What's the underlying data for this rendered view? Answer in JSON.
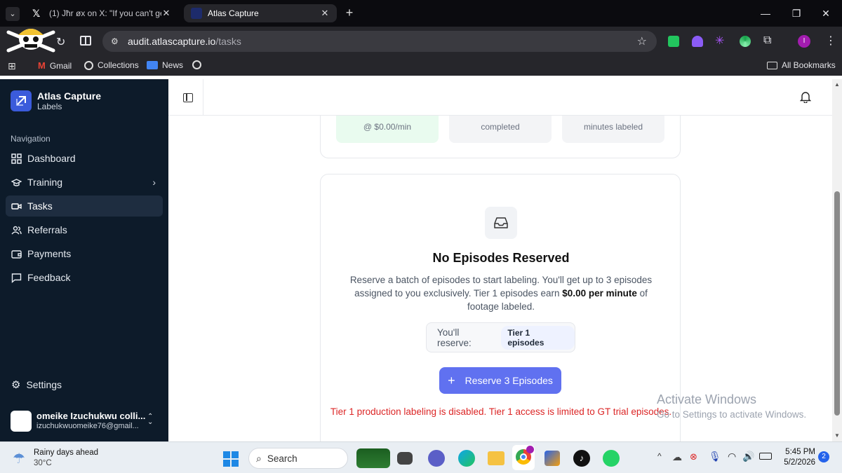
{
  "browser": {
    "tabs": [
      {
        "title": "(1) Jħr øx on X: \"If you can't get",
        "active": false
      },
      {
        "title": "Atlas Capture",
        "active": true
      }
    ],
    "url_domain": "audit.atlascapture.io",
    "url_path": "/tasks",
    "bookmarks": [
      "Gmail",
      "Collections",
      "News"
    ],
    "all_bookmarks": "All Bookmarks",
    "profile_initial": "I"
  },
  "app": {
    "name": "Atlas Capture",
    "subtitle": "Labels",
    "nav_heading": "Navigation",
    "nav": [
      {
        "label": "Dashboard",
        "icon": "dashboard-icon"
      },
      {
        "label": "Training",
        "icon": "training-icon"
      },
      {
        "label": "Tasks",
        "icon": "video-icon"
      },
      {
        "label": "Referrals",
        "icon": "users-icon"
      },
      {
        "label": "Payments",
        "icon": "wallet-icon"
      },
      {
        "label": "Feedback",
        "icon": "message-icon"
      }
    ],
    "settings_label": "Settings",
    "user": {
      "name": "omeike Izuchukwu colli...",
      "email": "izuchukwuomeike76@gmail..."
    }
  },
  "stats": [
    {
      "caption": "@ $0.00/min"
    },
    {
      "caption": "completed"
    },
    {
      "caption": "minutes labeled"
    }
  ],
  "empty_state": {
    "title": "No Episodes Reserved",
    "desc_line1": "Reserve a batch of episodes to start labeling. You'll get up to 3 episodes",
    "desc_line2a": "assigned to you exclusively. Tier 1 episodes earn ",
    "desc_bold": "$0.00 per minute",
    "desc_line2b": " of",
    "desc_line3": "footage labeled.",
    "reserve_label": "You'll reserve:",
    "reserve_pill": "Tier 1 episodes",
    "button_label": "Reserve 3 Episodes",
    "error": "Tier 1 production labeling is disabled. Tier 1 access is limited to GT trial episodes."
  },
  "watermark": {
    "title": "Activate Windows",
    "subtitle": "Go to Settings to activate Windows."
  },
  "taskbar": {
    "weather_title": "Rainy days ahead",
    "weather_temp": "30°C",
    "search_placeholder": "Search",
    "time": "5:45 PM",
    "date": "5/2/2026",
    "notification_count": "2"
  },
  "colors": {
    "sidebar_bg": "#0d1b2a",
    "accent": "#6071f0",
    "error": "#dc2626",
    "stat_highlight": "#e9fbef"
  }
}
